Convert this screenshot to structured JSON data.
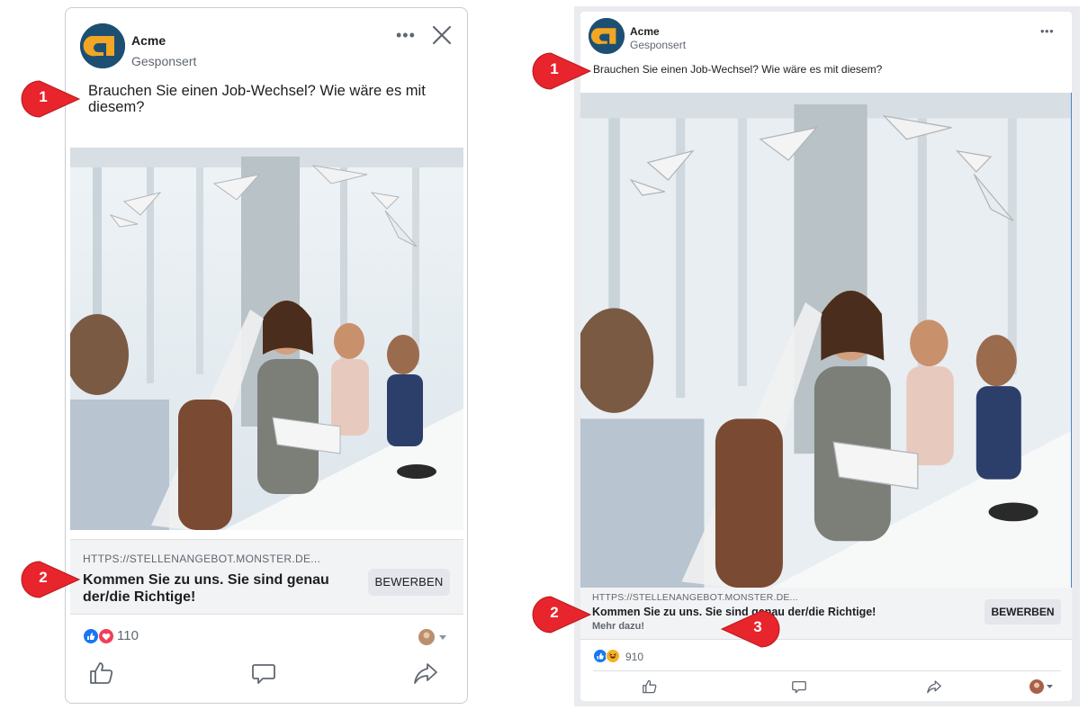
{
  "mobile_ad": {
    "page_name": "Acme",
    "sponsored_label": "Gesponsert",
    "more_icon": "•••",
    "close_icon": "close-icon",
    "primary_text": "Brauchen Sie einen Job-Wechsel? Wie wäre es mit diesem?",
    "link_domain": "HTTPS://STELLENANGEBOT.MONSTER.DE...",
    "headline": "Kommen Sie zu uns. Sie sind genau der/die Richtige!",
    "cta_label": "BEWERBEN",
    "reaction_count": "110",
    "reactions": [
      "like",
      "love"
    ],
    "actions": [
      "like-icon",
      "comment-icon",
      "share-icon"
    ]
  },
  "desktop_ad": {
    "page_name": "Acme",
    "sponsored_label": "Gesponsert",
    "more_icon": "•••",
    "primary_text": "Brauchen Sie einen Job-Wechsel? Wie wäre es mit diesem?",
    "link_domain": "HTTPS://STELLENANGEBOT.MONSTER.DE...",
    "headline": "Kommen Sie zu uns. Sie sind genau der/die Richtige!",
    "description": "Mehr dazu!",
    "cta_label": "BEWERBEN",
    "reaction_count": "910",
    "reactions": [
      "like",
      "haha"
    ],
    "actions": [
      "like-icon",
      "comment-icon",
      "share-icon",
      "avatar-select"
    ]
  },
  "callouts": [
    {
      "number": "1",
      "target": "mobile-primary-text"
    },
    {
      "number": "2",
      "target": "mobile-headline"
    },
    {
      "number": "1",
      "target": "desktop-primary-text"
    },
    {
      "number": "2",
      "target": "desktop-headline"
    },
    {
      "number": "3",
      "target": "desktop-description"
    }
  ],
  "colors": {
    "brand_logo_bg": "#1d4f73",
    "brand_logo_fg": "#f2a623",
    "callout_red": "#e8242c",
    "cta_bg": "#e4e6eb",
    "link_bar_bg": "#f2f3f5",
    "like_blue": "#1877f2",
    "love_red": "#f33e58",
    "haha_yellow": "#f7b125"
  }
}
